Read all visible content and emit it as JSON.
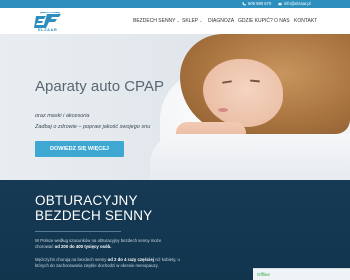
{
  "topbar": {
    "phone": "609 990 670",
    "email": "info@elzaar.pl",
    "color": "#2d8fbd"
  },
  "logo": {
    "text": "ELZAAR"
  },
  "nav": [
    {
      "label": "BEZDECH SENNY",
      "has_dropdown": true
    },
    {
      "label": "SKLEP",
      "has_dropdown": true
    },
    {
      "label": "DIAGNOZA",
      "has_dropdown": false
    },
    {
      "label": "GDZIE KUPIĆ?",
      "has_dropdown": false
    },
    {
      "label": "O NAS",
      "has_dropdown": false
    },
    {
      "label": "KONTAKT",
      "has_dropdown": false
    }
  ],
  "hero": {
    "title": "Aparaty auto CPAP",
    "subtitle1": "oraz maski i akcesoria",
    "subtitle2": "Zadbaj o zdrowie – popraw jakość swojego snu",
    "button": "DOWIEDZ SIĘ WIĘCEJ",
    "button_color": "#3ea8d2"
  },
  "section": {
    "title_line1": "OBTURACYJNY",
    "title_line2": "BEZDECH SENNY",
    "p1_a": "W Polsce według szacunków na obturacyjny bezdech senny może chorować ",
    "p1_b": "od 200 do 400 tysięcy osób.",
    "p2_a": "Mężczyźni chorują na bezdech senny ",
    "p2_b": "od 2 do 4 razy częściej",
    "p2_c": " niż kobiety, u których do zachorowania zwykle dochodzi w okresie menopauzy.",
    "bg_color": "#163a54"
  },
  "chat": {
    "status": "Offline",
    "color": "#2ea84a"
  }
}
